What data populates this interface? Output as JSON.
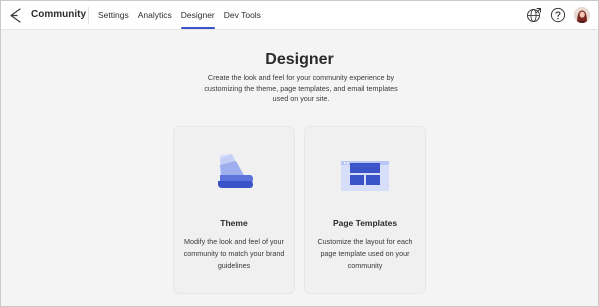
{
  "header": {
    "brand": "Community",
    "nav": [
      {
        "label": "Settings",
        "active": false
      },
      {
        "label": "Analytics",
        "active": false
      },
      {
        "label": "Designer",
        "active": true
      },
      {
        "label": "Dev Tools",
        "active": false
      }
    ],
    "icons": [
      "globe-icon",
      "help-icon",
      "user-avatar"
    ]
  },
  "main": {
    "title": "Designer",
    "description": "Create the look and feel for your community experience by customizing the theme, page templates, and email templates used on your site.",
    "cards": [
      {
        "title": "Theme",
        "description": "Modify the look and feel of your community to match your brand guidelines",
        "icon": "palette-fan-icon"
      },
      {
        "title": "Page Templates",
        "description": "Customize the layout for each page template used on your community",
        "icon": "page-template-icon"
      }
    ]
  },
  "colors": {
    "accent": "#3a53c9",
    "light_accent": "#a9b6ea",
    "lighter_accent": "#d7defa"
  }
}
